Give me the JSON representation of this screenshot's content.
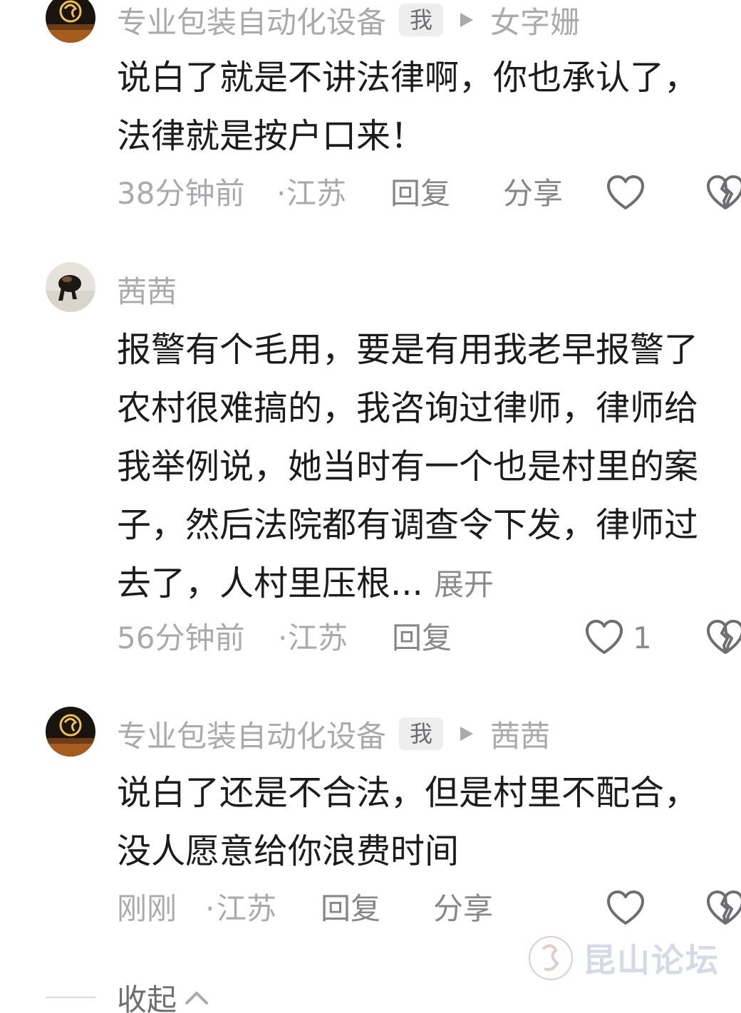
{
  "comments": [
    {
      "author": "专业包装自动化设备",
      "me_badge": "我",
      "reply_to": "女字姗",
      "lines": [
        "说白了就是不讲法律啊，你也承认了，",
        "法律就是按户口来！"
      ],
      "time": "38分钟前",
      "location": "江苏",
      "reply_label": "回复",
      "share_label": "分享"
    },
    {
      "author": "茜茜",
      "lines": [
        "报警有个毛用，要是有用我老早报警了",
        "农村很难搞的，我咨询过律师，律师给",
        "我举例说，她当时有一个也是村里的案",
        "子，然后法院都有调查令下发，律师过",
        "去了，人村里压根..."
      ],
      "expand_label": "展开",
      "time": "56分钟前",
      "location": "江苏",
      "reply_label": "回复",
      "like_count": "1"
    },
    {
      "author": "专业包装自动化设备",
      "me_badge": "我",
      "reply_to": "茜茜",
      "lines": [
        "说白了还是不合法，但是村里不配合，",
        "没人愿意给你浪费时间"
      ],
      "time": "刚刚",
      "location": "江苏",
      "reply_label": "回复",
      "share_label": "分享"
    }
  ],
  "separator": "·",
  "collapse_label": "收起",
  "watermark_text": "昆山论坛",
  "icons": [
    "heart-icon",
    "broken-heart-icon",
    "triangle-right-icon",
    "chevron-up-icon",
    "forum-logo-icon"
  ],
  "colors": {
    "text_primary": "#1c1c1e",
    "text_secondary": "#a9a9ae",
    "badge_bg": "#eeeeef",
    "icon_gray": "#6d6d72"
  }
}
